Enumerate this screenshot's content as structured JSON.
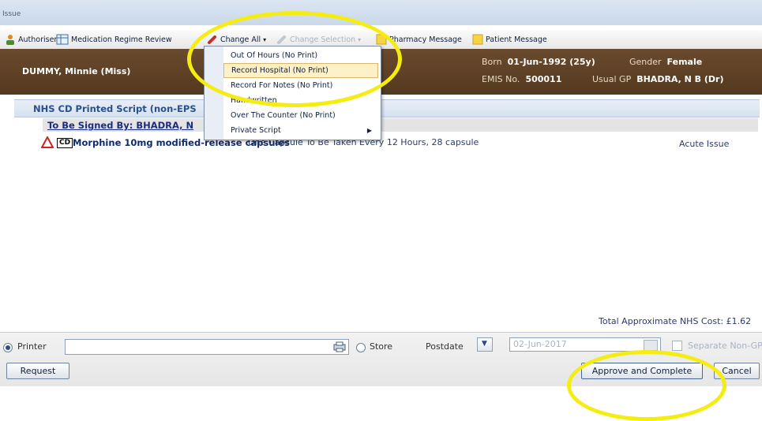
{
  "window": {
    "title": "Issue"
  },
  "toolbar": {
    "authoriser": "Authoriser",
    "medication_regime_review": "Medication Regime Review",
    "change_all": "Change All",
    "change_selection": "Change Selection",
    "pharmacy_message": "Pharmacy Message",
    "patient_message": "Patient Message"
  },
  "patient": {
    "name": "DUMMY, Minnie (Miss)",
    "born_label": "Born",
    "born_value": "01-Jun-1992 (25y)",
    "gender_label": "Gender",
    "gender_value": "Female",
    "emis_label": "EMIS No.",
    "emis_value": "500011",
    "usual_gp_label": "Usual GP",
    "usual_gp_value": "BHADRA, N B (Dr)"
  },
  "script": {
    "section_header": "NHS CD Printed Script (non-EPS",
    "signed_by": "To Be Signed By: BHADRA, N",
    "cd_badge": "CD",
    "drug_name": "Morphine 10mg modified-release capsules",
    "dosage": "One Capsule To Be Taken Every 12 Hours, 28 capsule",
    "issue_type": "Acute Issue",
    "warning_icon": "warning-triangle"
  },
  "change_all_menu": {
    "items": [
      "Out Of Hours (No Print)",
      "Record Hospital (No Print)",
      "Record For Notes (No Print)",
      "Handwritten",
      "Over The Counter (No Print)",
      "Private Script"
    ],
    "highlighted": "Record Hospital (No Print)"
  },
  "total_cost": "Total Approximate NHS Cost:  £1.62",
  "footer": {
    "printer_label": "Printer",
    "printer_value": "",
    "store_label": "Store",
    "postdate_label": "Postdate",
    "postdate_value": "02-Jun-2017",
    "separate_label": "Separate Non-GP",
    "request_button": "Request",
    "approve_button": "Approve and Complete",
    "cancel_button": "Cancel"
  },
  "colors": {
    "header_brown": "#5e4128",
    "highlight_yellow": "#f5ec11",
    "link_blue": "#1a2f83"
  }
}
